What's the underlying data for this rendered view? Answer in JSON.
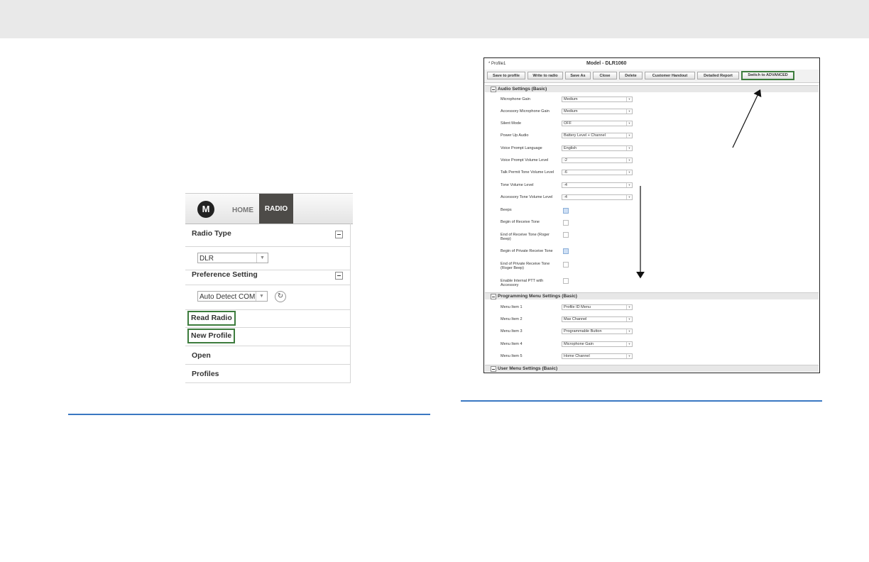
{
  "left_panel": {
    "logo": "M",
    "nav": [
      "HOME",
      "RADIO"
    ],
    "radio_type": {
      "label": "Radio Type",
      "value": "DLR"
    },
    "preference": {
      "label": "Preference Setting",
      "value": "Auto Detect COM"
    },
    "items": [
      "Read Radio",
      "New Profile",
      "Open",
      "Profiles"
    ]
  },
  "window": {
    "profile": "* Profile1",
    "model": "Model - DLR1060",
    "buttons": [
      "Save to profile",
      "Write to radio",
      "Save As",
      "Close",
      "Delete",
      "Customer Handout",
      "Detailed Report",
      "Switch to ADVANCED"
    ],
    "sections": [
      "Audio Settings (Basic)",
      "Programming Menu Settings (Basic)",
      "User Menu Settings (Basic)"
    ],
    "audio_rows": [
      {
        "label": "Microphone Gain",
        "value": "Medium"
      },
      {
        "label": "Accessory Microphone Gain",
        "value": "Medium"
      },
      {
        "label": "Silent Mode",
        "value": "OFF"
      },
      {
        "label": "Power Up Audio",
        "value": "Battery Level + Channel"
      },
      {
        "label": "Voice Prompt Language",
        "value": "English"
      },
      {
        "label": "Voice Prompt Volume Level",
        "value": "-2"
      },
      {
        "label": "Talk Permit Tone Volume Level",
        "value": "-6"
      },
      {
        "label": "Tone Volume Level",
        "value": "-4"
      },
      {
        "label": "Accessory Tone Volume Level",
        "value": "-4"
      }
    ],
    "checkbox_rows": [
      {
        "label": "Beeps",
        "checked": true
      },
      {
        "label": "Begin of Receive Tone",
        "checked": false
      },
      {
        "label": "End of Receive Tone (Roger Beep)",
        "checked": false
      },
      {
        "label": "Begin of Private Receive Tone",
        "checked": true
      },
      {
        "label": "End of Private Receive Tone (Roger Beep)",
        "checked": false
      },
      {
        "label": "Enable Internal PTT with Accessory",
        "checked": false
      }
    ],
    "menu_rows": [
      {
        "label": "Menu Item 1",
        "value": "Profile ID Menu"
      },
      {
        "label": "Menu Item 2",
        "value": "Max Channel"
      },
      {
        "label": "Menu Item 3",
        "value": "Programmable Button"
      },
      {
        "label": "Menu Item 4",
        "value": "Microphone Gain"
      },
      {
        "label": "Menu Item 5",
        "value": "Home Channel"
      }
    ]
  },
  "colors": {
    "highlight": "#3d7c3d",
    "rule": "#3a78c2",
    "active_tab": "#4d4b48"
  }
}
